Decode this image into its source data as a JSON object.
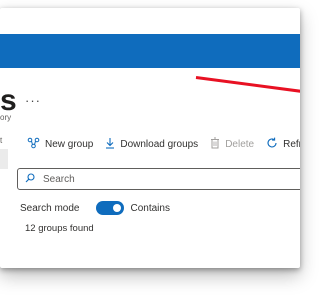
{
  "page": {
    "title": "s",
    "subtitle": "ory",
    "sidebar_fragment": "t",
    "more_icon": "more-icon",
    "more_glyph": "···"
  },
  "toolbar": {
    "new_group": {
      "label": "New group",
      "icon": "new-group-icon"
    },
    "download_groups": {
      "label": "Download groups",
      "icon": "download-icon"
    },
    "delete": {
      "label": "Delete",
      "icon": "delete-icon",
      "disabled": true
    },
    "refresh": {
      "label": "Refre",
      "icon": "refresh-icon"
    }
  },
  "search": {
    "placeholder": "Search",
    "value": ""
  },
  "search_mode": {
    "label": "Search mode",
    "option": "Contains",
    "enabled": true
  },
  "results": {
    "count_text": "12 groups found"
  },
  "colors": {
    "header_blue": "#0f6cbd",
    "accent": "#0f6cbd",
    "annotation_red": "#e81123",
    "text": "#323130",
    "disabled_text": "#a19f9d"
  }
}
